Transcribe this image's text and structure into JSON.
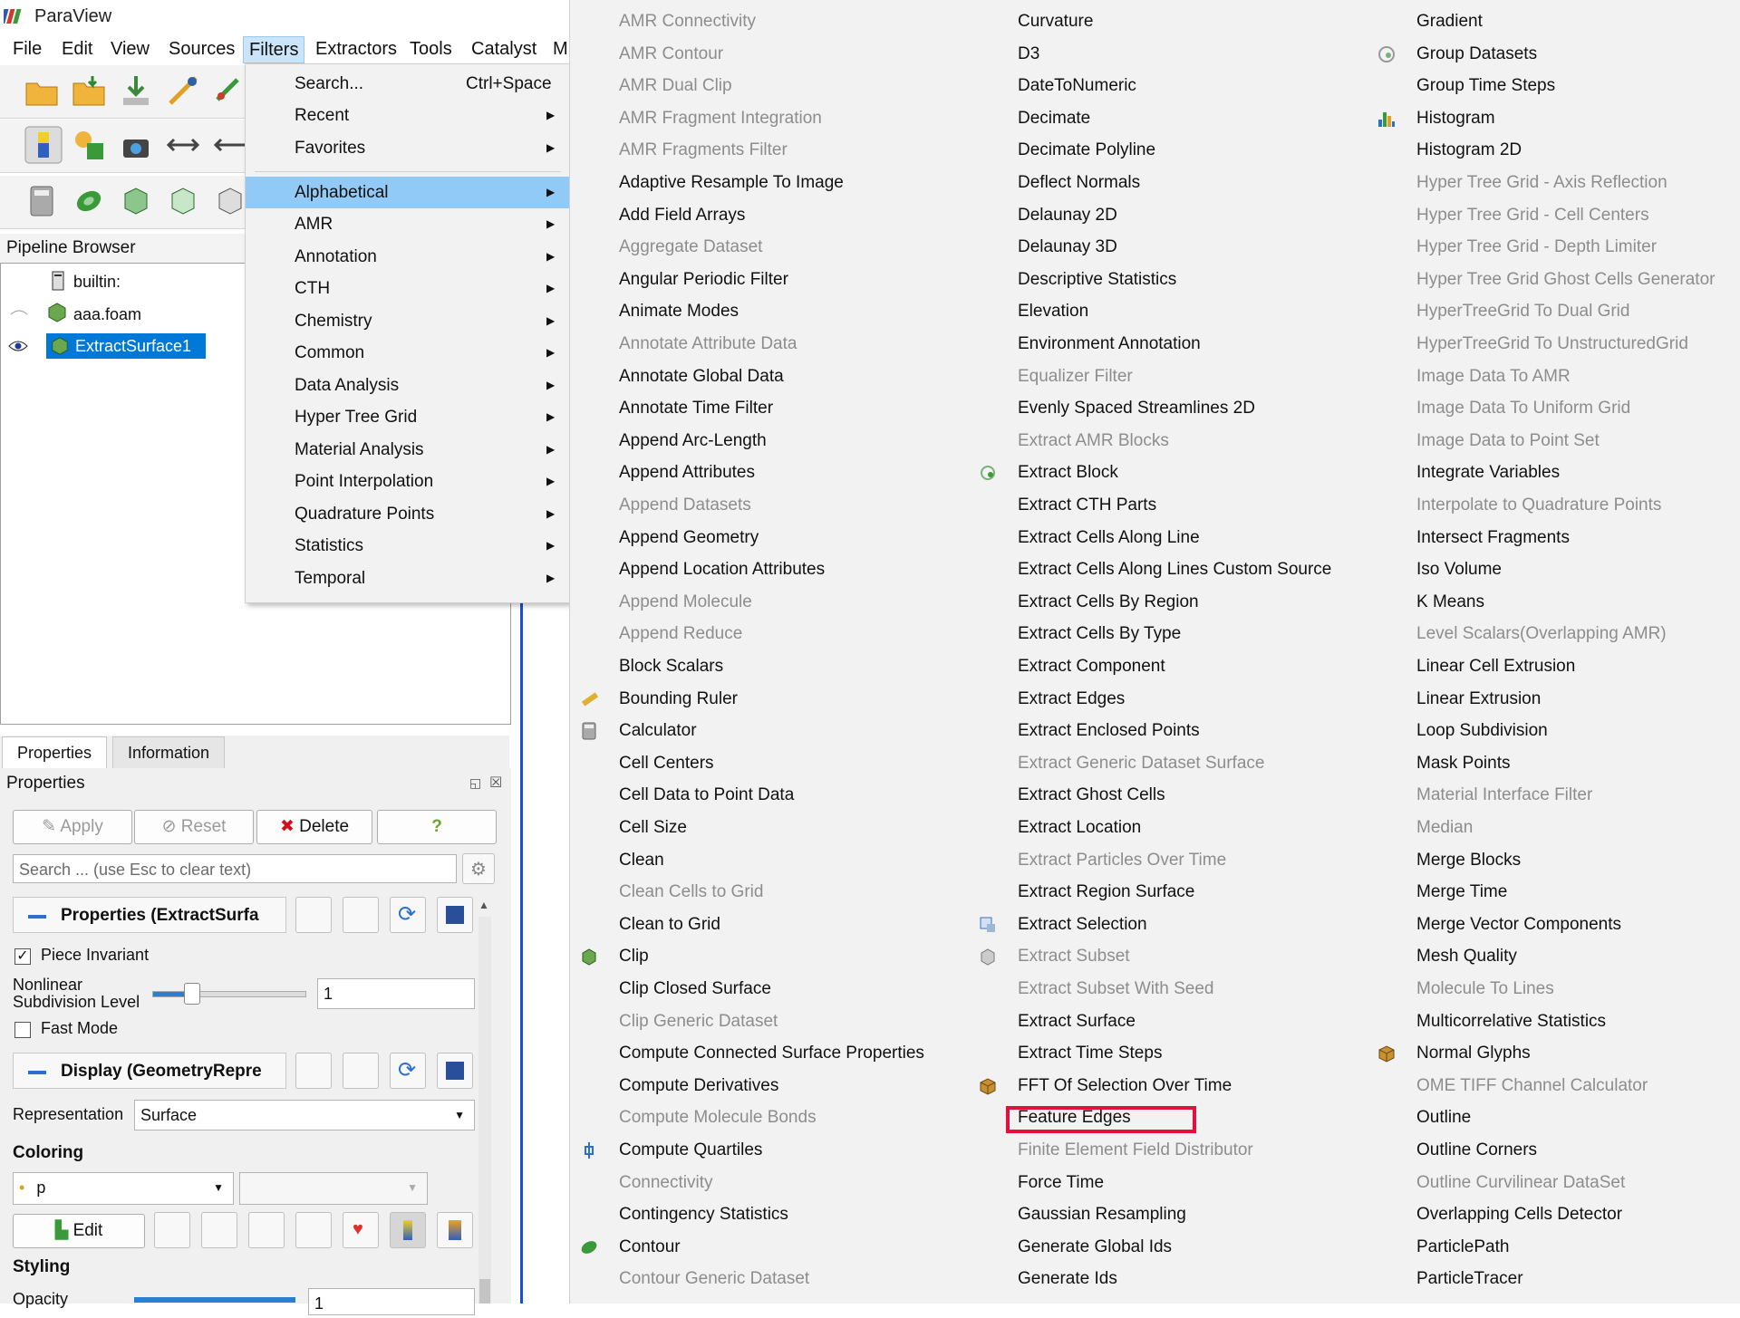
{
  "window": {
    "title": "ParaView"
  },
  "menubar": [
    "File",
    "Edit",
    "View",
    "Sources",
    "Filters",
    "Extractors",
    "Tools",
    "Catalyst",
    "M"
  ],
  "pipeline_browser": {
    "title": "Pipeline Browser",
    "items": [
      "builtin:",
      "aaa.foam",
      "ExtractSurface1"
    ]
  },
  "tabs": [
    "Properties",
    "Information"
  ],
  "properties": {
    "header": "Properties",
    "apply": "Apply",
    "reset": "Reset",
    "delete": "Delete",
    "help": "?",
    "search_placeholder": "Search ... (use Esc to clear text)",
    "section_properties": "Properties (ExtractSurfa",
    "piece_invariant": "Piece Invariant",
    "nonlinear_label_1": "Nonlinear",
    "nonlinear_label_2": "Subdivision Level",
    "nonlinear_value": "1",
    "nonlinear_fraction": 0.25,
    "fast_mode": "Fast Mode",
    "section_display": "Display (GeometryRepre",
    "representation_label": "Representation",
    "representation_value": "Surface",
    "coloring_title": "Coloring",
    "coloring_value": "p",
    "edit": "Edit",
    "styling_title": "Styling",
    "opacity_label": "Opacity",
    "opacity_value": "1"
  },
  "filters_menu": {
    "items": [
      {
        "label": "Search...",
        "shortcut": "Ctrl+Space",
        "submenu": false
      },
      {
        "label": "Recent",
        "submenu": true
      },
      {
        "label": "Favorites",
        "submenu": true
      },
      {
        "label": "Alphabetical",
        "submenu": true,
        "highlight": true
      },
      {
        "label": "AMR",
        "submenu": true
      },
      {
        "label": "Annotation",
        "submenu": true
      },
      {
        "label": "CTH",
        "submenu": true
      },
      {
        "label": "Chemistry",
        "submenu": true
      },
      {
        "label": "Common",
        "submenu": true
      },
      {
        "label": "Data Analysis",
        "submenu": true
      },
      {
        "label": "Hyper Tree Grid",
        "submenu": true
      },
      {
        "label": "Material Analysis",
        "submenu": true
      },
      {
        "label": "Point Interpolation",
        "submenu": true
      },
      {
        "label": "Quadrature Points",
        "submenu": true
      },
      {
        "label": "Statistics",
        "submenu": true
      },
      {
        "label": "Temporal",
        "submenu": true
      }
    ]
  },
  "alphabetical": {
    "col1": [
      {
        "t": "AMR Connectivity",
        "d": true
      },
      {
        "t": "AMR Contour",
        "d": true
      },
      {
        "t": "AMR Dual Clip",
        "d": true
      },
      {
        "t": "AMR Fragment Integration",
        "d": true
      },
      {
        "t": "AMR Fragments Filter",
        "d": true
      },
      {
        "t": "Adaptive Resample To Image"
      },
      {
        "t": "Add Field Arrays"
      },
      {
        "t": "Aggregate Dataset",
        "d": true
      },
      {
        "t": "Angular Periodic Filter"
      },
      {
        "t": "Animate Modes"
      },
      {
        "t": "Annotate Attribute Data",
        "d": true
      },
      {
        "t": "Annotate Global Data"
      },
      {
        "t": "Annotate Time Filter"
      },
      {
        "t": "Append Arc-Length"
      },
      {
        "t": "Append Attributes"
      },
      {
        "t": "Append Datasets",
        "d": true
      },
      {
        "t": "Append Geometry"
      },
      {
        "t": "Append Location Attributes"
      },
      {
        "t": "Append Molecule",
        "d": true
      },
      {
        "t": "Append Reduce",
        "d": true
      },
      {
        "t": "Block Scalars"
      },
      {
        "t": "Bounding Ruler",
        "icon": "ruler-icon"
      },
      {
        "t": "Calculator",
        "icon": "calculator-icon"
      },
      {
        "t": "Cell Centers"
      },
      {
        "t": "Cell Data to Point Data"
      },
      {
        "t": "Cell Size"
      },
      {
        "t": "Clean"
      },
      {
        "t": "Clean Cells to Grid",
        "d": true
      },
      {
        "t": "Clean to Grid"
      },
      {
        "t": "Clip",
        "icon": "clip-icon"
      },
      {
        "t": "Clip Closed Surface"
      },
      {
        "t": "Clip Generic Dataset",
        "d": true
      },
      {
        "t": "Compute Connected Surface Properties"
      },
      {
        "t": "Compute Derivatives"
      },
      {
        "t": "Compute Molecule Bonds",
        "d": true
      },
      {
        "t": "Compute Quartiles",
        "icon": "quartiles-icon"
      },
      {
        "t": "Connectivity",
        "d": true
      },
      {
        "t": "Contingency Statistics"
      },
      {
        "t": "Contour",
        "icon": "contour-icon"
      },
      {
        "t": "Contour Generic Dataset",
        "d": true
      }
    ],
    "col2": [
      {
        "t": "Curvature"
      },
      {
        "t": "D3"
      },
      {
        "t": "DateToNumeric"
      },
      {
        "t": "Decimate"
      },
      {
        "t": "Decimate Polyline"
      },
      {
        "t": "Deflect Normals"
      },
      {
        "t": "Delaunay 2D"
      },
      {
        "t": "Delaunay 3D"
      },
      {
        "t": "Descriptive Statistics"
      },
      {
        "t": "Elevation"
      },
      {
        "t": "Environment Annotation"
      },
      {
        "t": "Equalizer Filter",
        "d": true
      },
      {
        "t": "Evenly Spaced Streamlines 2D"
      },
      {
        "t": "Extract AMR Blocks",
        "d": true
      },
      {
        "t": "Extract Block",
        "icon": "extract-block-icon"
      },
      {
        "t": "Extract CTH Parts"
      },
      {
        "t": "Extract Cells Along Line"
      },
      {
        "t": "Extract Cells Along Lines Custom Source"
      },
      {
        "t": "Extract Cells By Region"
      },
      {
        "t": "Extract Cells By Type"
      },
      {
        "t": "Extract Component"
      },
      {
        "t": "Extract Edges"
      },
      {
        "t": "Extract Enclosed Points"
      },
      {
        "t": "Extract Generic Dataset Surface",
        "d": true
      },
      {
        "t": "Extract Ghost Cells"
      },
      {
        "t": "Extract Location"
      },
      {
        "t": "Extract Particles Over Time",
        "d": true
      },
      {
        "t": "Extract Region Surface"
      },
      {
        "t": "Extract Selection",
        "icon": "extract-selection-icon"
      },
      {
        "t": "Extract Subset",
        "d": true,
        "icon": "extract-subset-icon"
      },
      {
        "t": "Extract Subset With Seed",
        "d": true
      },
      {
        "t": "Extract Surface"
      },
      {
        "t": "Extract Time Steps"
      },
      {
        "t": "FFT Of Selection Over Time",
        "icon": "box-icon"
      },
      {
        "t": "Feature Edges"
      },
      {
        "t": "Finite Element Field Distributor",
        "d": true
      },
      {
        "t": "Force Time"
      },
      {
        "t": "Gaussian Resampling"
      },
      {
        "t": "Generate Global Ids"
      },
      {
        "t": "Generate Ids"
      }
    ],
    "col3": [
      {
        "t": "Gradient"
      },
      {
        "t": "Group Datasets",
        "icon": "group-icon"
      },
      {
        "t": "Group Time Steps"
      },
      {
        "t": "Histogram",
        "icon": "histogram-icon"
      },
      {
        "t": "Histogram 2D"
      },
      {
        "t": "Hyper Tree Grid - Axis Reflection",
        "d": true
      },
      {
        "t": "Hyper Tree Grid - Cell Centers",
        "d": true
      },
      {
        "t": "Hyper Tree Grid - Depth Limiter",
        "d": true
      },
      {
        "t": "Hyper Tree Grid Ghost Cells Generator",
        "d": true
      },
      {
        "t": "HyperTreeGrid To Dual Grid",
        "d": true
      },
      {
        "t": "HyperTreeGrid To UnstructuredGrid",
        "d": true
      },
      {
        "t": "Image Data To AMR",
        "d": true
      },
      {
        "t": "Image Data To Uniform Grid",
        "d": true
      },
      {
        "t": "Image Data to Point Set",
        "d": true
      },
      {
        "t": "Integrate Variables"
      },
      {
        "t": "Interpolate to Quadrature Points",
        "d": true
      },
      {
        "t": "Intersect Fragments"
      },
      {
        "t": "Iso Volume"
      },
      {
        "t": "K Means"
      },
      {
        "t": "Level Scalars(Overlapping AMR)",
        "d": true
      },
      {
        "t": "Linear Cell Extrusion"
      },
      {
        "t": "Linear Extrusion"
      },
      {
        "t": "Loop Subdivision"
      },
      {
        "t": "Mask Points"
      },
      {
        "t": "Material Interface Filter",
        "d": true
      },
      {
        "t": "Median",
        "d": true
      },
      {
        "t": "Merge Blocks"
      },
      {
        "t": "Merge Time"
      },
      {
        "t": "Merge Vector Components"
      },
      {
        "t": "Mesh Quality"
      },
      {
        "t": "Molecule To Lines",
        "d": true
      },
      {
        "t": "Multicorrelative Statistics"
      },
      {
        "t": "Normal Glyphs",
        "icon": "box-icon"
      },
      {
        "t": "OME TIFF Channel Calculator",
        "d": true
      },
      {
        "t": "Outline"
      },
      {
        "t": "Outline Corners"
      },
      {
        "t": "Outline Curvilinear DataSet",
        "d": true
      },
      {
        "t": "Overlapping Cells Detector"
      },
      {
        "t": "ParticlePath"
      },
      {
        "t": "ParticleTracer"
      }
    ]
  }
}
